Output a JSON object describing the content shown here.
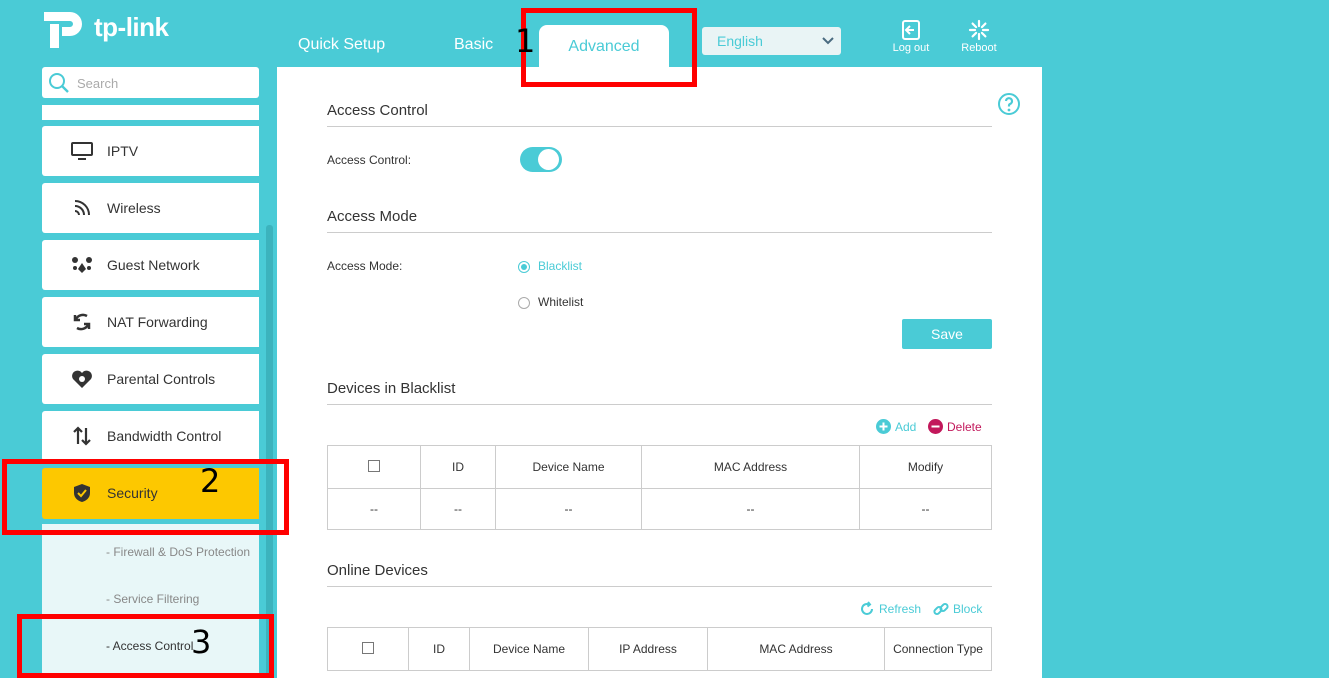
{
  "brand": {
    "name": "tp-link"
  },
  "nav": {
    "tabs": [
      {
        "label": "Quick Setup"
      },
      {
        "label": "Basic"
      },
      {
        "label": "Advanced"
      }
    ],
    "language": "English",
    "logout_label": "Log out",
    "reboot_label": "Reboot"
  },
  "sidebar": {
    "search_placeholder": "Search",
    "items": [
      {
        "label": "IPTV",
        "icon": "monitor-icon"
      },
      {
        "label": "Wireless",
        "icon": "wifi-icon"
      },
      {
        "label": "Guest Network",
        "icon": "guest-network-icon"
      },
      {
        "label": "NAT Forwarding",
        "icon": "nat-forwarding-icon"
      },
      {
        "label": "Parental Controls",
        "icon": "heart-icon"
      },
      {
        "label": "Bandwidth Control",
        "icon": "bandwidth-arrows-icon"
      },
      {
        "label": "Security",
        "icon": "shield-icon",
        "active": true
      }
    ],
    "subitems": [
      {
        "label": "- Firewall & DoS Protection"
      },
      {
        "label": "- Service Filtering"
      },
      {
        "label": "- Access Control"
      }
    ]
  },
  "main": {
    "access_control": {
      "title": "Access Control",
      "field_label": "Access Control:",
      "enabled": true
    },
    "access_mode": {
      "title": "Access Mode",
      "field_label": "Access Mode:",
      "options": [
        {
          "label": "Blacklist",
          "selected": true
        },
        {
          "label": "Whitelist",
          "selected": false
        }
      ],
      "save_label": "Save"
    },
    "blacklist": {
      "title": "Devices in Blacklist",
      "add_label": "Add",
      "delete_label": "Delete",
      "columns": [
        "ID",
        "Device Name",
        "MAC Address",
        "Modify"
      ],
      "rows": [
        [
          "--",
          "--",
          "--",
          "--",
          "--"
        ]
      ]
    },
    "online": {
      "title": "Online Devices",
      "refresh_label": "Refresh",
      "block_label": "Block",
      "columns": [
        "ID",
        "Device Name",
        "IP Address",
        "MAC Address",
        "Connection Type"
      ]
    }
  },
  "annotations": {
    "markers": [
      "1",
      "2",
      "3"
    ]
  },
  "colors": {
    "accent": "#4acbd6",
    "active": "#fdc800",
    "delete": "#c2185b",
    "highlight": "#ff0000"
  }
}
